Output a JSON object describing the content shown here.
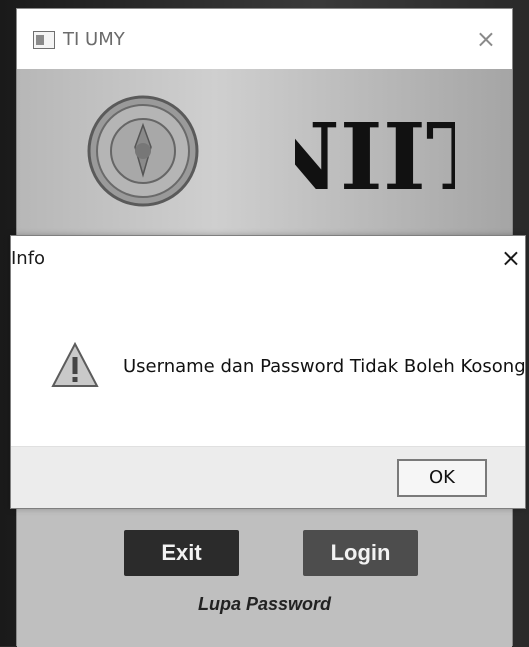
{
  "main_window": {
    "title": "TI UMY",
    "close_glyph": "×",
    "app_icon": "app-icon"
  },
  "header": {
    "university_seal": "university-seal-logo",
    "brand_text": "NIIT"
  },
  "buttons": {
    "exit_label": "Exit",
    "login_label": "Login"
  },
  "links": {
    "forgot_password": "Lupa Password"
  },
  "dialog": {
    "title": "Info",
    "close_glyph": "×",
    "message": "Username dan Password Tidak Boleh Kosong",
    "icon": "warning-icon",
    "ok_label": "OK"
  }
}
